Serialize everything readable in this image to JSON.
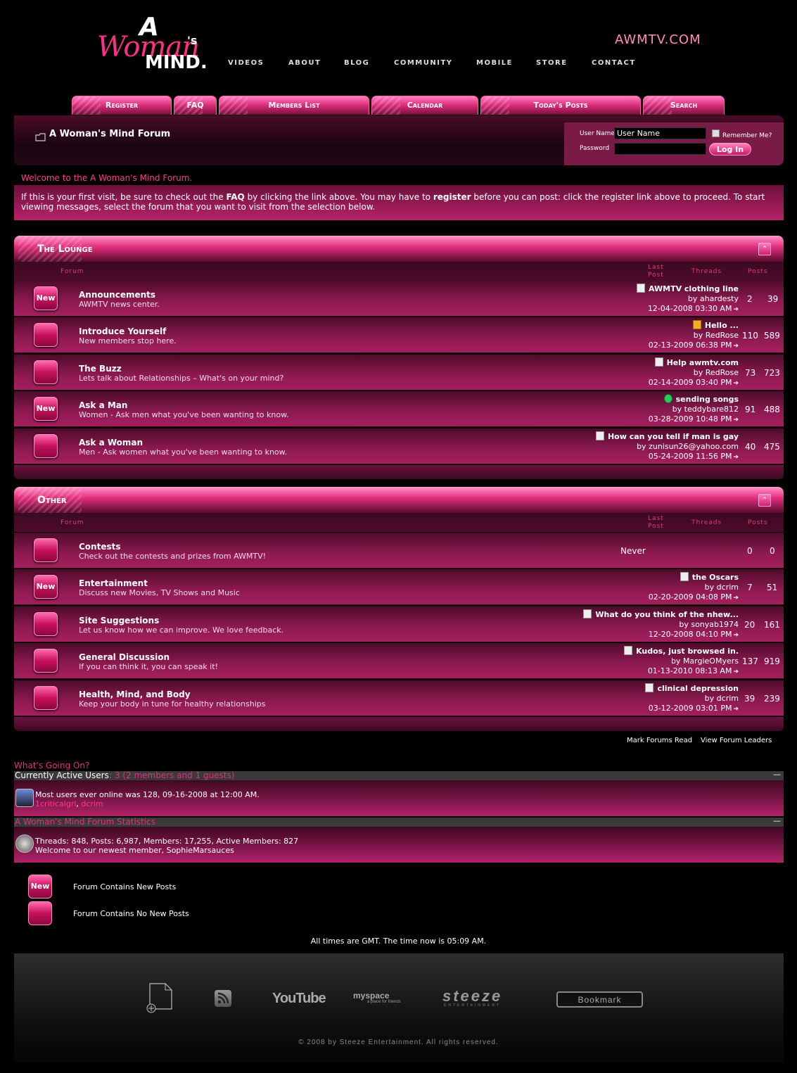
{
  "header": {
    "logo": {
      "a": "A",
      "woman": "Woman",
      "s": "'s",
      "mind": "MIND."
    },
    "site_name": "AWMTV.COM",
    "nav": [
      "VIDEOS",
      "ABOUT",
      "BLOG",
      "COMMUNITY",
      "MOBILE",
      "STORE",
      "CONTACT"
    ]
  },
  "tabs": [
    "Register",
    "FAQ",
    "Members List",
    "Calendar",
    "Today's Posts",
    "Search"
  ],
  "breadcrumb": {
    "title": "A Woman's Mind Forum"
  },
  "login": {
    "username_label": "User Name",
    "username_value": "User Name",
    "password_label": "Password",
    "remember_label": "Remember Me?",
    "button": "Log In"
  },
  "welcome": "Welcome to the A Woman's Mind Forum.",
  "intro": {
    "p1": "If this is your first visit, be sure to check out the ",
    "faq": "FAQ",
    "p2": " by clicking the link above. You may have to ",
    "register": "register",
    "p3": " before you can post: click the register link above to proceed. To start viewing messages, select the forum that you want to visit from the selection below."
  },
  "columns": {
    "forum": "Forum",
    "last_post_1": "Last",
    "last_post_2": "Post",
    "threads": "Threads",
    "posts": "Posts"
  },
  "collapse_icon": "chevron-up-icon",
  "categories": [
    {
      "title": "The Lounge",
      "forums": [
        {
          "new": true,
          "new_label": "New",
          "title": "Announcements",
          "desc": "AWMTV news center.",
          "lp_icon": "document-icon",
          "lp_title": "AWMTV clothing line",
          "lp_by": "by ahardesty",
          "lp_date": "12-04-2008 03:30 AM",
          "threads": "2",
          "posts": "39"
        },
        {
          "new": false,
          "title": "Introduce Yourself",
          "desc": "New members stop here.",
          "lp_icon": "thumbs-up-icon",
          "lp_title": "Hello ...",
          "lp_by": "by RedRose",
          "lp_date": "02-13-2009 06:38 PM",
          "threads": "110",
          "posts": "589"
        },
        {
          "new": false,
          "title": "The Buzz",
          "desc": "Lets talk about Relationships – What's on your mind?",
          "lp_icon": "document-icon",
          "lp_title": "Help awmtv.com",
          "lp_by": "by RedRose",
          "lp_date": "02-14-2009 03:40 PM",
          "threads": "73",
          "posts": "723"
        },
        {
          "new": true,
          "new_label": "New",
          "title": "Ask a Man",
          "desc": "Women - Ask men what you've been wanting to know.",
          "lp_icon": "arrow-circle-icon",
          "lp_title": "sending songs",
          "lp_by": "by teddybare812",
          "lp_date": "03-28-2009 10:48 PM",
          "threads": "91",
          "posts": "488"
        },
        {
          "new": false,
          "title": "Ask a Woman",
          "desc": "Men - Ask women what you've been wanting to know.",
          "lp_icon": "document-icon",
          "lp_title": "How can you tell if man is gay",
          "lp_by": "by zunisun26@yahoo.com",
          "lp_date": "05-24-2009 11:56 PM",
          "threads": "40",
          "posts": "475"
        }
      ]
    },
    {
      "title": "Other",
      "forums": [
        {
          "new": false,
          "title": "Contests",
          "desc": "Check out the contests and prizes from AWMTV!",
          "never": "Never",
          "threads": "0",
          "posts": "0"
        },
        {
          "new": true,
          "new_label": "New",
          "title": "Entertainment",
          "desc": "Discuss new Movies, TV Shows and Music",
          "lp_icon": "document-icon",
          "lp_title": "the Oscars",
          "lp_by": "by dcrim",
          "lp_date": "02-20-2009 04:08 PM",
          "threads": "7",
          "posts": "51"
        },
        {
          "new": false,
          "title": "Site Suggestions",
          "desc": "Let us know how we can improve. We love feedback.",
          "lp_icon": "document-icon",
          "lp_title": "What do you think of the nhew...",
          "lp_by": "by sonyab1974",
          "lp_date": "12-20-2008 04:10 PM",
          "threads": "20",
          "posts": "161"
        },
        {
          "new": false,
          "title": "General Discussion",
          "desc": "If you can think it, you can speak it!",
          "lp_icon": "document-icon",
          "lp_title": "Kudos, just browsed in.",
          "lp_by": "by MargieOMyers",
          "lp_date": "01-13-2010 08:13 AM",
          "threads": "137",
          "posts": "919"
        },
        {
          "new": false,
          "title": "Health, Mind, and Body",
          "desc": "Keep your body in tune for healthy relationships",
          "lp_icon": "document-icon",
          "lp_title": "clinical depression",
          "lp_by": "by dcrim",
          "lp_date": "03-12-2009 03:01 PM",
          "threads": "39",
          "posts": "239"
        }
      ]
    }
  ],
  "links": {
    "mark_read": "Mark Forums Read",
    "leaders": "View Forum Leaders"
  },
  "whats_going_on": {
    "title": "What's Going On?",
    "active_label": "Currently Active Users",
    "active_count": ": 3 (2 members and 1 guests)",
    "most_users": "Most users ever online was 128, 09-16-2008 at 12:00 AM.",
    "user1": "1criticalgrl",
    "sep": ", ",
    "user2": "dcrim",
    "stats_title": "A Woman's Mind Forum Statistics",
    "stats": "Threads: 848, Posts: 6,987, Members: 17,255, Active Members: 827",
    "newest": "Welcome to our newest member, SophieMarsauces",
    "minimize": "—"
  },
  "legend": {
    "new_label": "New",
    "new_posts": "Forum Contains New Posts",
    "no_new": "Forum Contains No New Posts"
  },
  "time_notice": "All times are GMT. The time now is 05:09 AM.",
  "footer": {
    "youtube": "YouTube",
    "myspace": "myspace",
    "myspace_tag": "a place for friends",
    "steeze": "steeze",
    "steeze_tag": "ENTERTAINMENT",
    "bookmark": "Bookmark",
    "copyright": "© 2008  by  Steeze Entertainment.  All rights reserved."
  },
  "colors": {
    "accent": "#e0307e",
    "panel": "#7a1a46",
    "link": "#ff3c8a"
  }
}
